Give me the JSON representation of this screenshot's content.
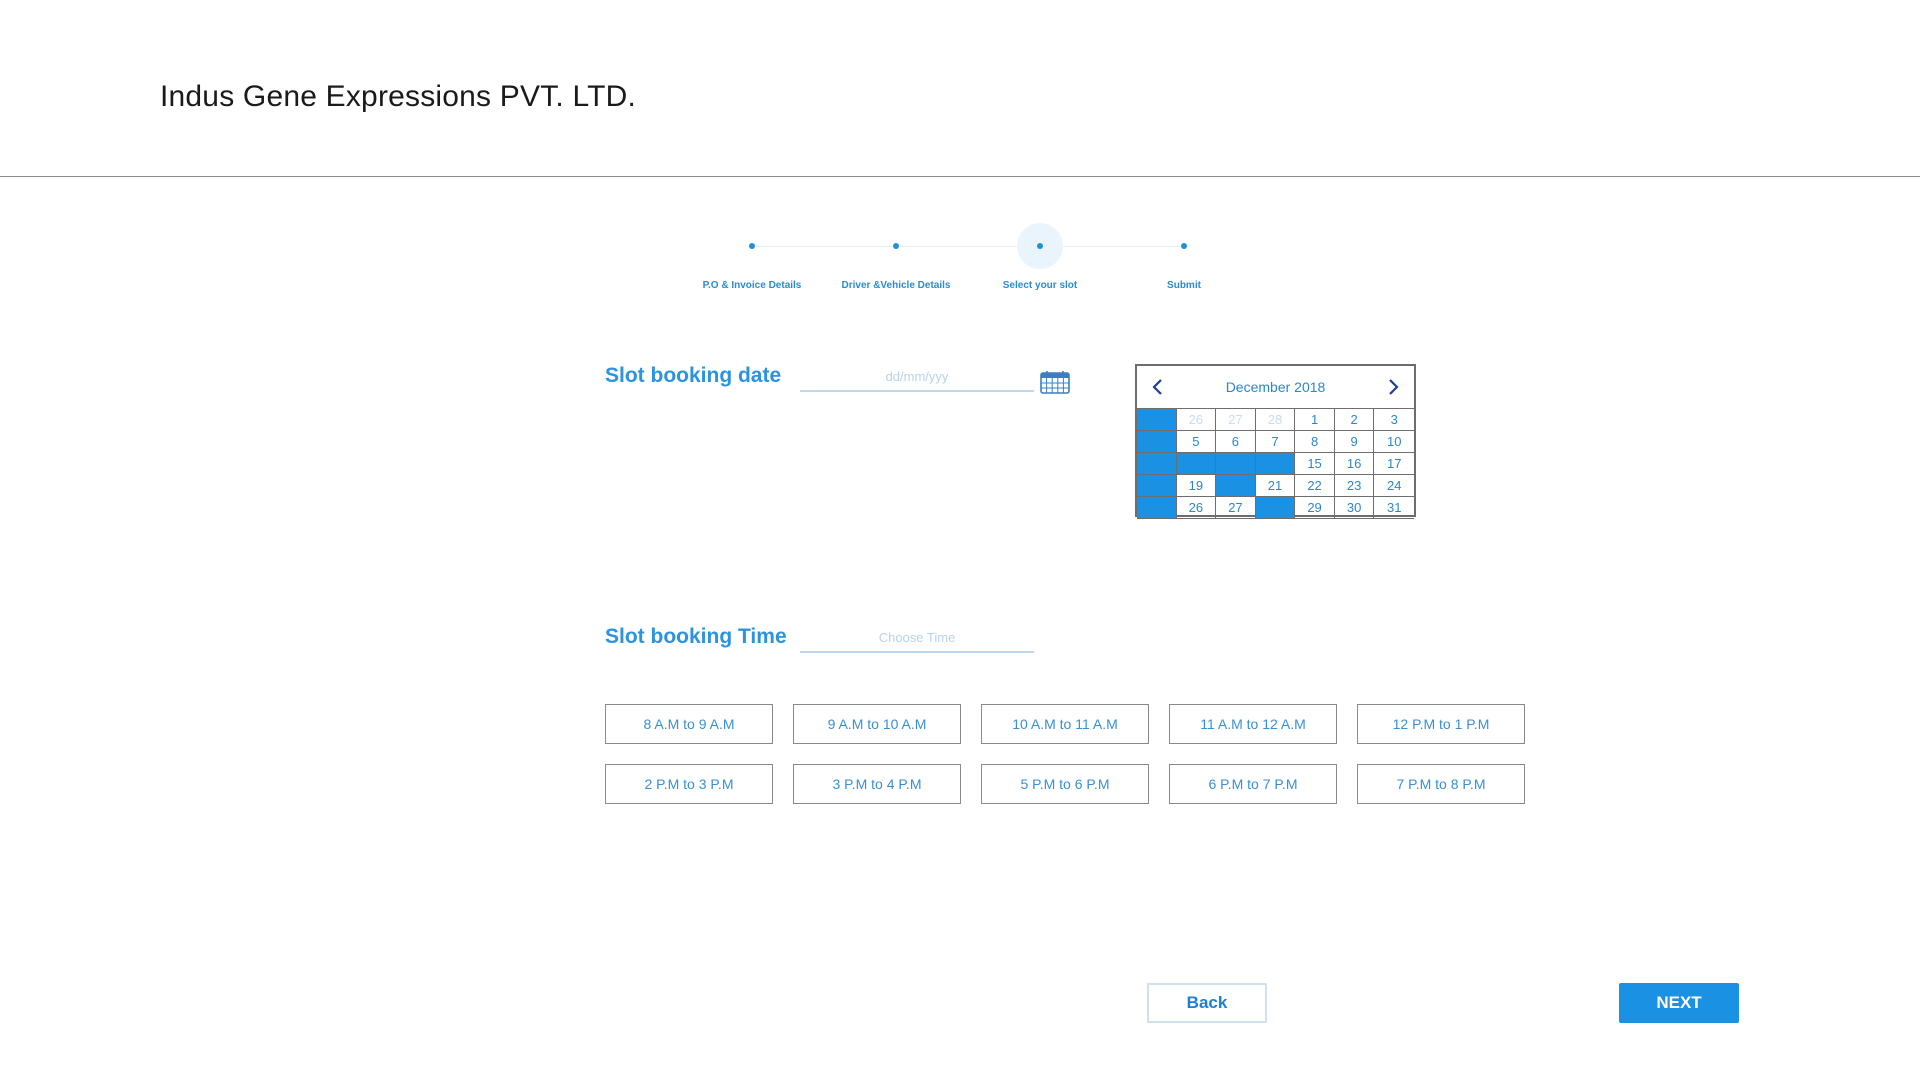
{
  "header": {
    "title": "Indus Gene Expressions PVT. LTD."
  },
  "stepper": {
    "steps": [
      {
        "label": "P.O & Invoice Details"
      },
      {
        "label": "Driver &Vehicle Details"
      },
      {
        "label": "Select your slot",
        "active": true
      },
      {
        "label": "Submit"
      }
    ]
  },
  "date_field": {
    "label": "Slot booking date",
    "placeholder": "dd/mm/yyy",
    "icon": "calendar-icon"
  },
  "calendar": {
    "month_label": "December  2018",
    "prev_icon": "chevron-left-icon",
    "next_icon": "chevron-right-icon",
    "blocked_color": "#1a91e2",
    "cells": [
      {
        "text": "",
        "state": "blocked"
      },
      {
        "text": "26",
        "state": "muted"
      },
      {
        "text": "27",
        "state": "muted"
      },
      {
        "text": "28",
        "state": "muted"
      },
      {
        "text": "1",
        "state": "normal"
      },
      {
        "text": "2",
        "state": "normal"
      },
      {
        "text": "3",
        "state": "normal"
      },
      {
        "text": "",
        "state": "blocked"
      },
      {
        "text": "5",
        "state": "normal"
      },
      {
        "text": "6",
        "state": "normal"
      },
      {
        "text": "7",
        "state": "normal"
      },
      {
        "text": "8",
        "state": "normal"
      },
      {
        "text": "9",
        "state": "normal"
      },
      {
        "text": "10",
        "state": "normal"
      },
      {
        "text": "",
        "state": "blocked"
      },
      {
        "text": "",
        "state": "blocked"
      },
      {
        "text": "",
        "state": "blocked"
      },
      {
        "text": "",
        "state": "blocked"
      },
      {
        "text": "15",
        "state": "normal"
      },
      {
        "text": "16",
        "state": "normal"
      },
      {
        "text": "17",
        "state": "normal"
      },
      {
        "text": "",
        "state": "blocked"
      },
      {
        "text": "19",
        "state": "normal"
      },
      {
        "text": "",
        "state": "blocked"
      },
      {
        "text": "21",
        "state": "normal"
      },
      {
        "text": "22",
        "state": "normal"
      },
      {
        "text": "23",
        "state": "normal"
      },
      {
        "text": "24",
        "state": "normal"
      },
      {
        "text": "",
        "state": "blocked"
      },
      {
        "text": "26",
        "state": "normal"
      },
      {
        "text": "27",
        "state": "normal"
      },
      {
        "text": "",
        "state": "blocked"
      },
      {
        "text": "29",
        "state": "normal"
      },
      {
        "text": "30",
        "state": "normal"
      },
      {
        "text": "31",
        "state": "normal"
      }
    ]
  },
  "time_field": {
    "label": "Slot booking Time",
    "placeholder": "Choose Time"
  },
  "time_slots": [
    "8 A.M to 9 A.M",
    "9 A.M to 10 A.M",
    "10 A.M to 11 A.M",
    "11 A.M to 12 A.M",
    "12 P.M to 1 P.M",
    "2 P.M to 3 P.M",
    "3 P.M to 4 P.M",
    "5 P.M to 6 P.M",
    "6 P.M to 7 P.M",
    "7 P.M to 8 P.M"
  ],
  "actions": {
    "back_label": "Back",
    "next_label": "NEXT"
  },
  "colors": {
    "accent": "#1a91e2",
    "label": "#2b93e0"
  }
}
